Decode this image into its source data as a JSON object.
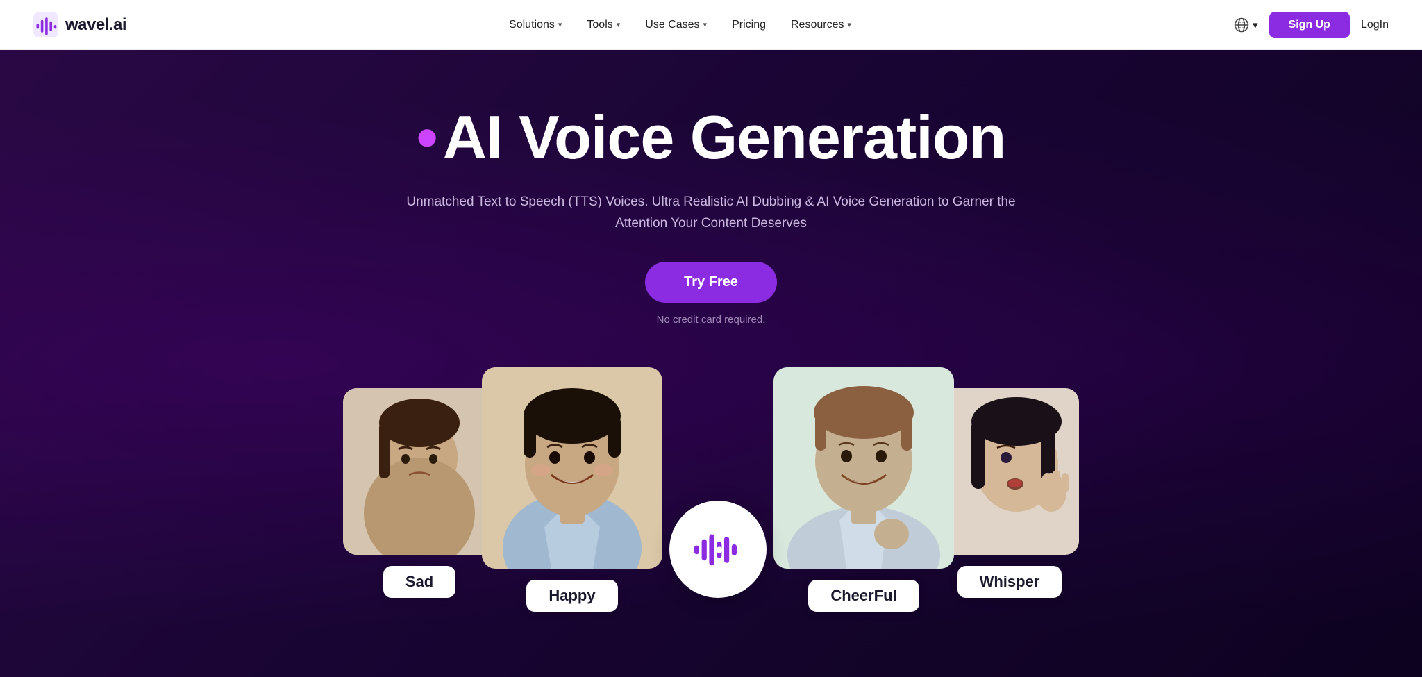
{
  "nav": {
    "logo_text": "wavel.ai",
    "links": [
      {
        "label": "Solutions",
        "has_dropdown": true
      },
      {
        "label": "Tools",
        "has_dropdown": true
      },
      {
        "label": "Use Cases",
        "has_dropdown": true
      },
      {
        "label": "Pricing",
        "has_dropdown": false
      },
      {
        "label": "Resources",
        "has_dropdown": true
      }
    ],
    "signup_label": "Sign Up",
    "login_label": "LogIn",
    "globe_chevron": "▾"
  },
  "hero": {
    "title_dot": "•",
    "title_text": "AI Voice Generation",
    "subtitle": "Unmatched Text to Speech (TTS) Voices. Ultra Realistic AI Dubbing & AI Voice Generation to Garner the Attention Your Content Deserves",
    "try_free_label": "Try Free",
    "no_card_text": "No credit card required."
  },
  "voice_cards": [
    {
      "id": "sad",
      "label": "Sad",
      "emoji": "😔"
    },
    {
      "id": "happy",
      "label": "Happy",
      "emoji": "😁"
    },
    {
      "id": "center",
      "label": ""
    },
    {
      "id": "cheerful",
      "label": "CheerFul",
      "emoji": "😄"
    },
    {
      "id": "whisper",
      "label": "Whisper",
      "emoji": "🤫"
    }
  ],
  "colors": {
    "brand_purple": "#8b2be2",
    "nav_bg": "#ffffff",
    "hero_bg_start": "#2a0845",
    "hero_bg_end": "#0d0220"
  }
}
